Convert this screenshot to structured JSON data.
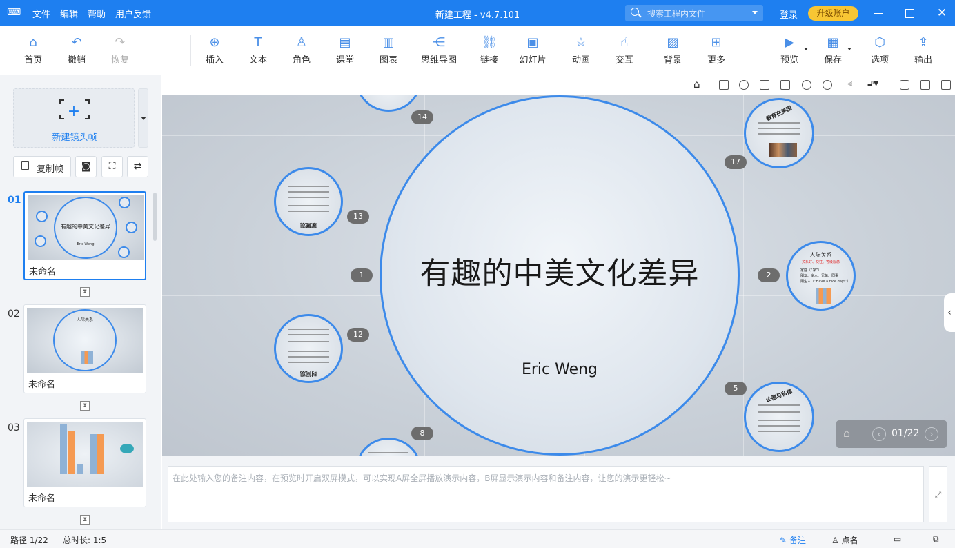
{
  "titlebar": {
    "menu": [
      "文件",
      "编辑",
      "帮助",
      "用户反馈"
    ],
    "title": "新建工程 - v4.7.101",
    "search_placeholder": "搜索工程内文件",
    "login": "登录",
    "upgrade": "升级账户"
  },
  "toolbar": {
    "home": "首页",
    "undo": "撤销",
    "redo": "恢复",
    "insert": "插入",
    "text": "文本",
    "role": "角色",
    "classroom": "课堂",
    "chart": "图表",
    "mindmap": "思维导图",
    "link": "链接",
    "slide": "幻灯片",
    "animation": "动画",
    "interaction": "交互",
    "background": "背景",
    "more": "更多",
    "preview": "预览",
    "save": "保存",
    "options": "选项",
    "export": "输出"
  },
  "leftpanel": {
    "new_frame": "新建镜头帧",
    "copy_frame": "复制帧",
    "slides": [
      {
        "num": "01",
        "name": "未命名",
        "thumb_title": "有趣的中美文化差异",
        "thumb_sub": "Eric Weng"
      },
      {
        "num": "02",
        "name": "未命名",
        "thumb_title": "人际关系"
      },
      {
        "num": "03",
        "name": "未命名"
      }
    ]
  },
  "canvas": {
    "title": "有趣的中美文化差异",
    "subtitle": "Eric Weng",
    "badges": [
      "14",
      "17",
      "13",
      "1",
      "2",
      "12",
      "5",
      "8"
    ],
    "circle_titles": {
      "c17": "教育在美国",
      "c2": "人际关系",
      "c2_sub": "关系好、交往、等级观念",
      "c5": "公德与私德",
      "c13": "家庭观",
      "c12": "时间观"
    },
    "c2_lines": [
      "家庭（“家”）",
      "朋友、家人、兄弟、同事",
      "陌生人（“Have a nice day!”）"
    ]
  },
  "navigator": {
    "page": "01/22"
  },
  "notes": {
    "placeholder": "在此处输入您的备注内容，在预览时开启双屏模式，可以实现A屏全屏播放演示内容，B屏显示演示内容和备注内容，让您的演示更轻松~"
  },
  "statusbar": {
    "path": "路径 1/22",
    "duration": "总时长: 1:5",
    "notes": "备注",
    "rollcall": "点名"
  },
  "colors": {
    "accent": "#1e7ff0",
    "circle_border": "#3c8aea",
    "upgrade": "#f8c634"
  }
}
